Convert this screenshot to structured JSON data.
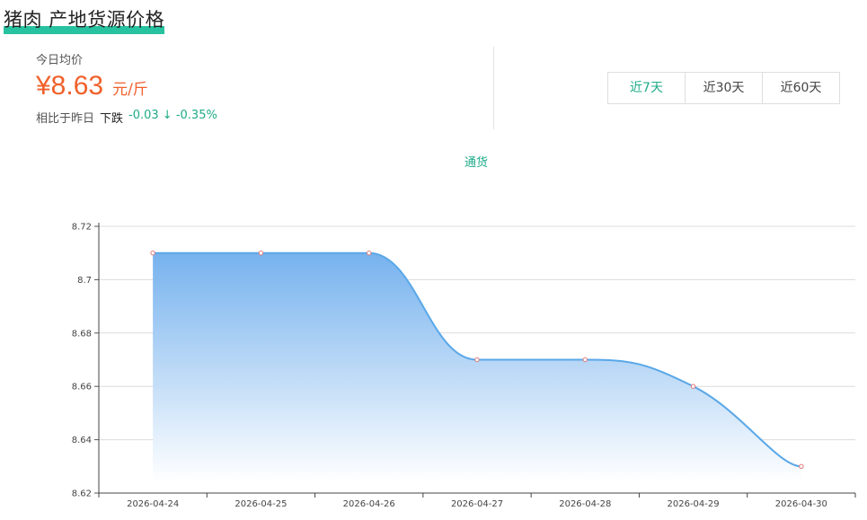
{
  "header": {
    "title": "猪肉 产地货源价格"
  },
  "summary": {
    "today_label": "今日均价",
    "price": "¥8.63",
    "unit": "元/斤",
    "compare_label": "相比于昨日",
    "compare_direction": "下跌",
    "compare_value": "-0.03 ↓ -0.35%"
  },
  "range_tabs": [
    {
      "label": "近7天",
      "active": true
    },
    {
      "label": "近30天",
      "active": false
    },
    {
      "label": "近60天",
      "active": false
    }
  ],
  "chart_data": {
    "type": "area",
    "x": [
      "2026-04-24",
      "2026-04-25",
      "2026-04-26",
      "2026-04-27",
      "2026-04-28",
      "2026-04-29",
      "2026-04-30"
    ],
    "series": [
      {
        "name": "通货",
        "values": [
          8.71,
          8.71,
          8.71,
          8.67,
          8.67,
          8.66,
          8.63
        ]
      }
    ],
    "ylim": [
      8.62,
      8.72
    ],
    "yticks": [
      "8.72",
      "8.7",
      "8.68",
      "8.66",
      "8.64",
      "8.62"
    ],
    "grid": true,
    "legend_position": "top-center",
    "colors": {
      "line": "#5aa8e8",
      "fill_top": "#76b2ee",
      "fill_bottom": "#ffffff",
      "marker": "#e07a7a"
    }
  }
}
